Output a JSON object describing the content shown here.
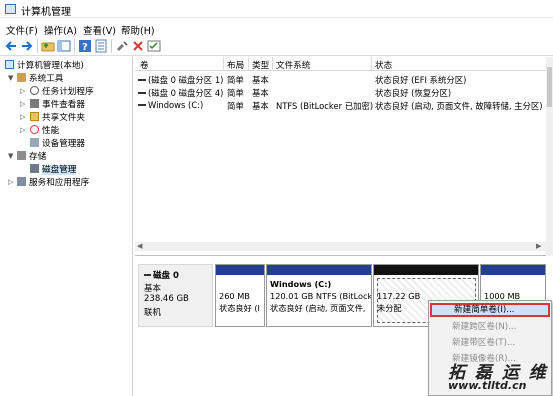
{
  "window": {
    "title": "计算机管理"
  },
  "menu": [
    "文件(F)",
    "操作(A)",
    "查看(V)",
    "帮助(H)"
  ],
  "toolbar_icons": [
    "back-icon",
    "forward-icon",
    "folder-up-icon",
    "show-tree-icon",
    "help-icon",
    "properties-icon",
    "connect-icon",
    "delete-icon",
    "check-icon"
  ],
  "tree": {
    "root": "计算机管理(本地)",
    "system_tools": "系统工具",
    "task_scheduler": "任务计划程序",
    "event_viewer": "事件查看器",
    "shared_folders": "共享文件夹",
    "performance": "性能",
    "device_manager": "设备管理器",
    "storage": "存储",
    "disk_management": "磁盘管理",
    "services_apps": "服务和应用程序"
  },
  "volume_list": {
    "columns": [
      "卷",
      "布局",
      "类型",
      "文件系统",
      "状态"
    ],
    "rows": [
      {
        "volume": "(磁盘 0 磁盘分区 1)",
        "layout": "简单",
        "type": "基本",
        "fs": "",
        "status": "状态良好 (EFI 系统分区)"
      },
      {
        "volume": "(磁盘 0 磁盘分区 4)",
        "layout": "简单",
        "type": "基本",
        "fs": "",
        "status": "状态良好 (恢复分区)"
      },
      {
        "volume": "Windows (C:)",
        "layout": "简单",
        "type": "基本",
        "fs": "NTFS (BitLocker 已加密)",
        "status": "状态良好 (启动, 页面文件, 故障转储, 主分区)"
      }
    ]
  },
  "disk": {
    "name": "磁盘 0",
    "kind": "基本",
    "size": "238.46 GB",
    "state": "联机",
    "partitions": [
      {
        "line1": "",
        "line2": "260 MB",
        "line3": "状态良好 (I"
      },
      {
        "line1": "Windows  (C:)",
        "line2": "120.01 GB NTFS (BitLocke",
        "line3": "状态良好 (启动, 页面文件,"
      },
      {
        "line1": "",
        "line2": "117.22 GB",
        "line3": "未分配"
      },
      {
        "line1": "",
        "line2": "1000 MB",
        "line3": ""
      }
    ]
  },
  "context_menu": {
    "items": [
      {
        "label": "新建简单卷(I)...",
        "enabled": true
      },
      {
        "label": "新建跨区卷(N)...",
        "enabled": false
      },
      {
        "label": "新建带区卷(T)...",
        "enabled": false
      },
      {
        "label": "新建镜像卷(R)...",
        "enabled": false
      }
    ]
  },
  "watermark": {
    "cn": "拓 磊 运 维",
    "url": "www.tlltd.cn"
  },
  "colors": {
    "partition_bar": "#233f8f",
    "unallocated_bar": "#111111",
    "highlight": "#cbe3f8",
    "highlight_border": "#d9353b"
  }
}
